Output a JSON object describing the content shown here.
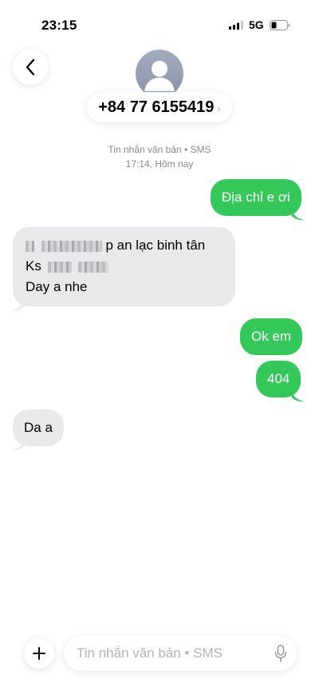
{
  "status_bar": {
    "time": "23:15",
    "network": "5G"
  },
  "header": {
    "contact": "+84 77 6155419",
    "chevron": "›"
  },
  "thread_meta": {
    "service": "Tin nhắn văn bản • SMS",
    "time": "17:14, Hôm nay"
  },
  "messages": [
    {
      "direction": "sent",
      "text": "Địa chỉ e ơi"
    },
    {
      "direction": "received",
      "lines": [
        "p an lạc binh tân",
        "Ks",
        "Day a nhe"
      ],
      "redacted": true
    },
    {
      "direction": "sent",
      "text": "Ok em"
    },
    {
      "direction": "sent",
      "text": "404"
    },
    {
      "direction": "received",
      "text": "Da a"
    }
  ],
  "composer": {
    "placeholder": "Tin nhắn văn bản • SMS"
  },
  "icons": {
    "back": "chevron-left-icon",
    "plus": "plus-icon",
    "mic": "microphone-icon",
    "avatar": "person-silhouette-icon",
    "signal": "cellular-signal-icon",
    "battery": "battery-icon"
  },
  "colors": {
    "sent_bubble": "#34c759",
    "received_bubble": "#e9e9eb",
    "meta_text": "#8a8a8e"
  }
}
